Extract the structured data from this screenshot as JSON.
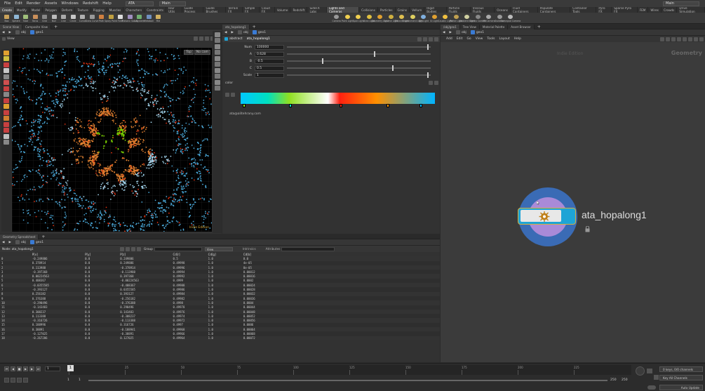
{
  "menubar": {
    "items": [
      "File",
      "Edit",
      "Render",
      "Assets",
      "Windows",
      "Redshift",
      "Help"
    ],
    "desktop_label": "ATA",
    "context_label": "Main",
    "build_label": "Main"
  },
  "shelf_tabs_left": [
    "Create",
    "Modify",
    "Model",
    "Polygon",
    "Deform",
    "Texture",
    "Rigging",
    "Muscles",
    "Characters",
    "Constraints",
    "Hair Utils",
    "Guide Process",
    "Guide Brushes",
    "Terrain FX",
    "Simple FX",
    "Cloud FX",
    "Volume",
    "Redshift",
    "SideFX Labs"
  ],
  "shelf_tabs_right": [
    "Lights and Cameras",
    "Collisions",
    "Particles",
    "Grains",
    "Vellum",
    "Rigid Bodies",
    "Particle Fluids",
    "Viscous Fluids",
    "Oceans",
    "Fluid Containers",
    "Populate Containers",
    "Container Tools",
    "Pyro FX",
    "Sparse Pyro FX",
    "FEM",
    "Wires",
    "Crowds",
    "Drive Simulation"
  ],
  "tools_left": [
    "Box",
    "Sphere",
    "Tube",
    "Torus",
    "Grid",
    "Null",
    "Line",
    "Circle",
    "Curve",
    "Draw Curve",
    "Path",
    "Spray Paint",
    "Font",
    "Platonic Solids",
    "L-System",
    "Metaball",
    "File"
  ],
  "tools_right": [
    "Camera",
    "Point Light",
    "Spot Light",
    "Area Light",
    "Geometry Light",
    "Volume Light",
    "Distant Light",
    "Environment Light",
    "Sky Light",
    "GI Light",
    "Caustic Light",
    "Portal Light",
    "Ambient Light",
    "Stereo Camera",
    "VR Camera",
    "Switcher",
    "Gamepad Camera"
  ],
  "scene_view": {
    "tabs": [
      "Scene View",
      "Composite View"
    ],
    "path": [
      "obj",
      "geo1"
    ],
    "title": "View",
    "camera_button": "Top",
    "cam_dropdown": "No cam",
    "edition_label": "Indie Edition"
  },
  "params": {
    "tabs": [
      "ata_hopalong1"
    ],
    "path": [
      "obj",
      "geo1"
    ],
    "node_type": "abstract",
    "node_name": "ata_hopalong1",
    "fields": [
      {
        "label": "Num",
        "value": "100000",
        "slider": 1.0
      },
      {
        "label": "A",
        "value": "0.628",
        "slider": 0.62
      },
      {
        "label": "B",
        "value": "-0.5",
        "slider": 0.25
      },
      {
        "label": "C",
        "value": "0.5",
        "slider": 0.75
      },
      {
        "label": "Scale",
        "value": "1",
        "slider": 1.0
      }
    ],
    "color_label": "color",
    "email": "ata@alitehrany.com"
  },
  "spreadsheet": {
    "tab": "Geometry Spreadsheet",
    "path": [
      "obj",
      "geo1"
    ],
    "node_label": "Node: ata_hopalong1",
    "group_label": "Group",
    "view_label": "View",
    "intrinsics_label": "Intrinsics",
    "attributes_label": "Attributes",
    "columns": [
      "",
      "P[x]",
      "P[y]",
      "P[z]",
      "Cd[r]",
      "Cd[g]",
      "Cd[b]"
    ],
    "rows": [
      [
        "0",
        "-0.249886",
        "0.0",
        "0.249886",
        "0.5",
        "1.0",
        "0.0"
      ],
      [
        "1",
        "0.378914",
        "0.0",
        "0.249886",
        "0.49998",
        "1.0",
        "4e-05"
      ],
      [
        "2",
        "0.113988",
        "0.0",
        "-0.378914",
        "0.49996",
        "1.0",
        "8e-05"
      ],
      [
        "3",
        "-0.397368",
        "0.0",
        "-0.113988",
        "0.49994",
        "1.0",
        "0.00012"
      ],
      [
        "4",
        "0.00224563",
        "0.0",
        "0.397368",
        "0.49992",
        "1.0",
        "0.00016"
      ],
      [
        "5",
        "0.408367",
        "0.0",
        "-0.00224563",
        "0.4999",
        "1.0",
        "0.0002"
      ],
      [
        "6",
        "-0.0355585",
        "0.0",
        "-0.408367",
        "0.49988",
        "1.0",
        "0.00024"
      ],
      [
        "7",
        "-0.393127",
        "0.0",
        "0.0355585",
        "0.49986",
        "1.0",
        "0.00028"
      ],
      [
        "8",
        "0.256182",
        "0.0",
        "0.393127",
        "0.49984",
        "1.0",
        "0.00032"
      ],
      [
        "9",
        "0.376388",
        "0.0",
        "-0.256182",
        "0.49982",
        "1.0",
        "0.00036"
      ],
      [
        "10",
        "-0.290496",
        "0.0",
        "-0.376388",
        "0.4998",
        "1.0",
        "0.0004"
      ],
      [
        "11",
        "-0.143483",
        "0.0",
        "0.290496",
        "0.49978",
        "1.0",
        "0.00044"
      ],
      [
        "12",
        "0.308237",
        "0.0",
        "0.143483",
        "0.49976",
        "1.0",
        "0.00048"
      ],
      [
        "13",
        "0.113388",
        "0.0",
        "-0.308237",
        "0.49974",
        "1.0",
        "0.00052"
      ],
      [
        "14",
        "-0.316726",
        "0.0",
        "-0.113388",
        "0.49972",
        "1.0",
        "0.00056"
      ],
      [
        "15",
        "0.188996",
        "0.0",
        "0.316726",
        "0.4997",
        "1.0",
        "0.0006"
      ],
      [
        "16",
        "0.38891",
        "0.0",
        "-0.188941",
        "0.49968",
        "1.0",
        "0.00064"
      ],
      [
        "17",
        "-0.127025",
        "0.0",
        "-0.38891",
        "0.49966",
        "1.0",
        "0.00068"
      ],
      [
        "18",
        "-0.267286",
        "0.0",
        "0.127025",
        "0.49964",
        "1.0",
        "0.00072"
      ]
    ]
  },
  "network": {
    "tabs": [
      "/obj/geo1",
      "Tree View",
      "Material Palette",
      "Asset Browser"
    ],
    "path": [
      "obj",
      "geo1"
    ],
    "menu": [
      "Add",
      "Edit",
      "Go",
      "View",
      "Tools",
      "Layout",
      "Help"
    ],
    "edition_label": "Indie Edition",
    "context_label": "Geometry",
    "node_name": "ata_hopalong1"
  },
  "timeline": {
    "ticks": [
      "1",
      "25",
      "50",
      "75",
      "100",
      "125",
      "150",
      "175",
      "200",
      "225"
    ],
    "current_frame": "1",
    "start_frame": "1",
    "range_start": "1",
    "range_start2": "1",
    "end_frame": "250",
    "end_frame2": "250",
    "keys_label": "0 keys, 0/0 channels",
    "key_all_label": "Key All Channels",
    "auto_update_label": "Auto Update"
  },
  "colors": {
    "accent_blue": "#1ea4d6",
    "ramp": [
      "#00c8ff",
      "#00e0c0",
      "#90e020",
      "#ffffff",
      "#ff2010",
      "#ff9000",
      "#00b4ff"
    ]
  }
}
